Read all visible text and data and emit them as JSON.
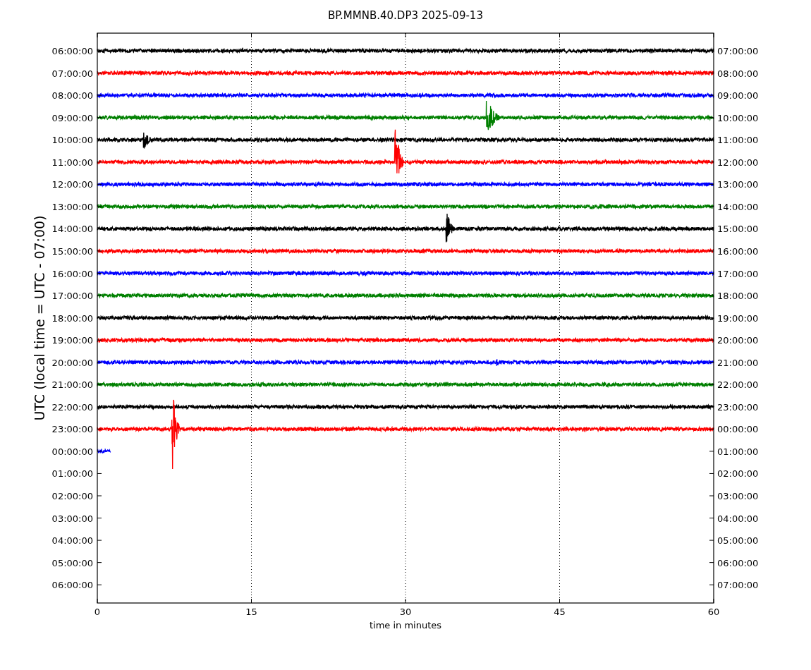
{
  "chart": {
    "title": "BP.MMNB.40.DP3 2025-09-13",
    "ylabel": "UTC (local time = UTC - 07:00)",
    "xlabel": "time in minutes",
    "xticks": [
      "0",
      "15",
      "30",
      "45",
      "60"
    ],
    "left_labels": [
      "06:00:00",
      "07:00:00",
      "08:00:00",
      "09:00:00",
      "10:00:00",
      "11:00:00",
      "12:00:00",
      "13:00:00",
      "14:00:00",
      "15:00:00",
      "16:00:00",
      "17:00:00",
      "18:00:00",
      "19:00:00",
      "20:00:00",
      "21:00:00",
      "22:00:00",
      "23:00:00",
      "00:00:00",
      "01:00:00",
      "02:00:00",
      "03:00:00",
      "04:00:00",
      "05:00:00",
      "06:00:00"
    ],
    "right_labels": [
      "07:00:00",
      "08:00:00",
      "09:00:00",
      "10:00:00",
      "11:00:00",
      "12:00:00",
      "13:00:00",
      "14:00:00",
      "15:00:00",
      "16:00:00",
      "17:00:00",
      "18:00:00",
      "19:00:00",
      "20:00:00",
      "21:00:00",
      "22:00:00",
      "23:00:00",
      "00:00:00",
      "01:00:00",
      "02:00:00",
      "03:00:00",
      "04:00:00",
      "05:00:00",
      "06:00:00",
      "07:00:00"
    ],
    "traces": [
      {
        "color": "#000000",
        "kind": "full"
      },
      {
        "color": "#ff0000",
        "kind": "full"
      },
      {
        "color": "#0000ff",
        "kind": "full"
      },
      {
        "color": "#008000",
        "kind": "full"
      },
      {
        "color": "#000000",
        "kind": "full"
      },
      {
        "color": "#ff0000",
        "kind": "full"
      },
      {
        "color": "#0000ff",
        "kind": "full"
      },
      {
        "color": "#008000",
        "kind": "full"
      },
      {
        "color": "#000000",
        "kind": "full"
      },
      {
        "color": "#ff0000",
        "kind": "full"
      },
      {
        "color": "#0000ff",
        "kind": "full"
      },
      {
        "color": "#008000",
        "kind": "full"
      },
      {
        "color": "#000000",
        "kind": "full"
      },
      {
        "color": "#ff0000",
        "kind": "full"
      },
      {
        "color": "#0000ff",
        "kind": "full"
      },
      {
        "color": "#008000",
        "kind": "full"
      },
      {
        "color": "#000000",
        "kind": "full"
      },
      {
        "color": "#ff0000",
        "kind": "full"
      },
      {
        "color": "#0000ff",
        "kind": "partial"
      }
    ]
  }
}
